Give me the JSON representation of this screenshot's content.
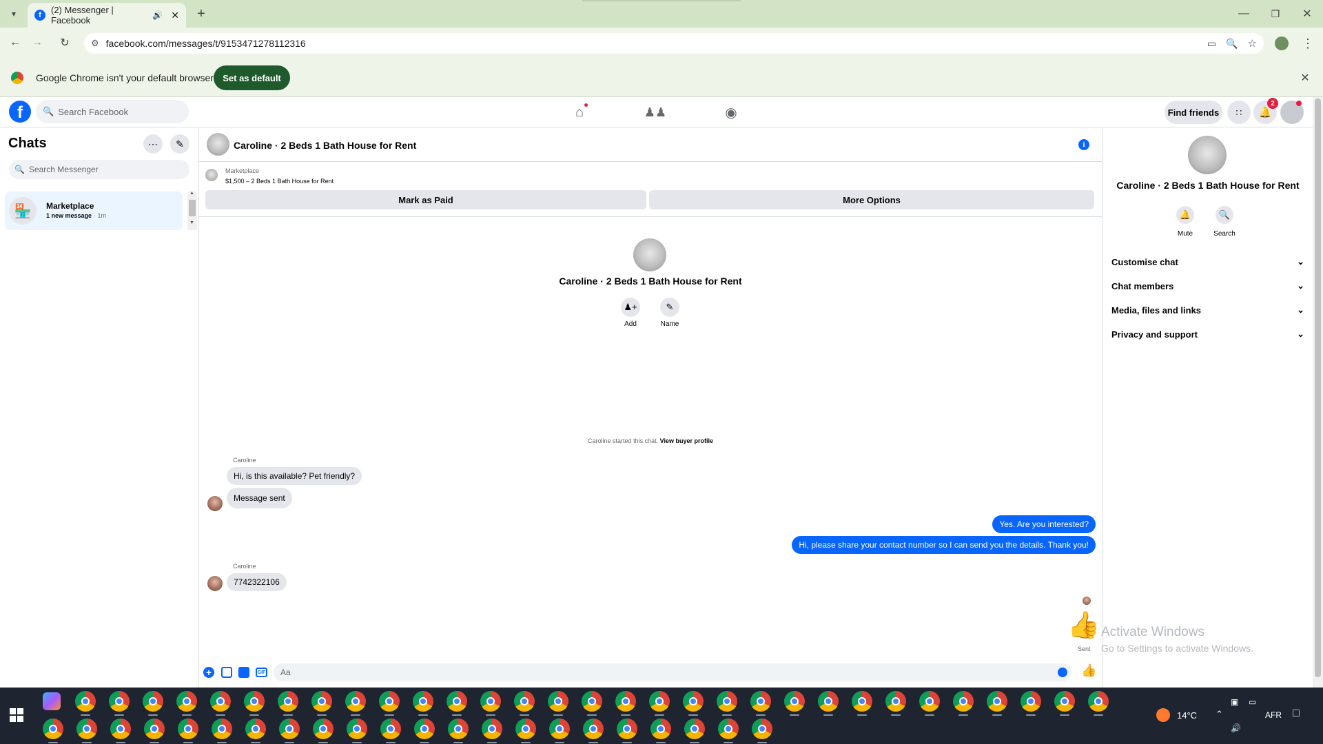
{
  "browser": {
    "tab_title": "(2) Messenger | Facebook",
    "url": "facebook.com/messages/t/9153471278112316",
    "infobar_text": "Google Chrome isn't your default browser",
    "set_default_label": "Set as default"
  },
  "fb": {
    "search_placeholder": "Search Facebook",
    "find_friends": "Find friends",
    "notification_count": "2"
  },
  "chats": {
    "title": "Chats",
    "search_placeholder": "Search Messenger",
    "items": [
      {
        "name": "Marketplace",
        "preview": "1 new message",
        "time": "· 1m"
      }
    ]
  },
  "conversation": {
    "title": "Caroline · 2 Beds 1 Bath House for Rent",
    "listing_source": "Marketplace",
    "listing_line": "$1,500 – 2 Beds 1 Bath House for Rent",
    "mark_paid": "Mark as Paid",
    "more_options": "More Options",
    "center_title": "Caroline · 2 Beds 1 Bath House for Rent",
    "add_label": "Add",
    "name_label": "Name",
    "started_text": "Caroline started this chat.",
    "view_buyer": "View buyer profile",
    "messages": [
      {
        "sender": "Caroline",
        "text": "Hi, is this available? Pet friendly?"
      },
      {
        "text": "Message sent"
      },
      {
        "text": "Yes. Are you interested?"
      },
      {
        "text": "Hi, please share your contact number so I can send you the details. Thank you!"
      },
      {
        "sender": "Caroline",
        "text": "7742322106"
      }
    ],
    "sent_label": "Sent",
    "composer_placeholder": "Aa"
  },
  "details": {
    "title": "Caroline · 2 Beds 1 Bath House for Rent",
    "mute": "Mute",
    "search": "Search",
    "sections": [
      "Customise chat",
      "Chat members",
      "Media, files and links",
      "Privacy and support"
    ]
  },
  "watermark": {
    "line1": "Activate Windows",
    "line2": "Go to Settings to activate Windows."
  },
  "taskbar": {
    "temperature": "14°C",
    "language": "AFR"
  },
  "colors": {
    "accent": "#0866ff",
    "tabbar": "#d3e3c5",
    "chrome_green": "#1e5a2c"
  }
}
